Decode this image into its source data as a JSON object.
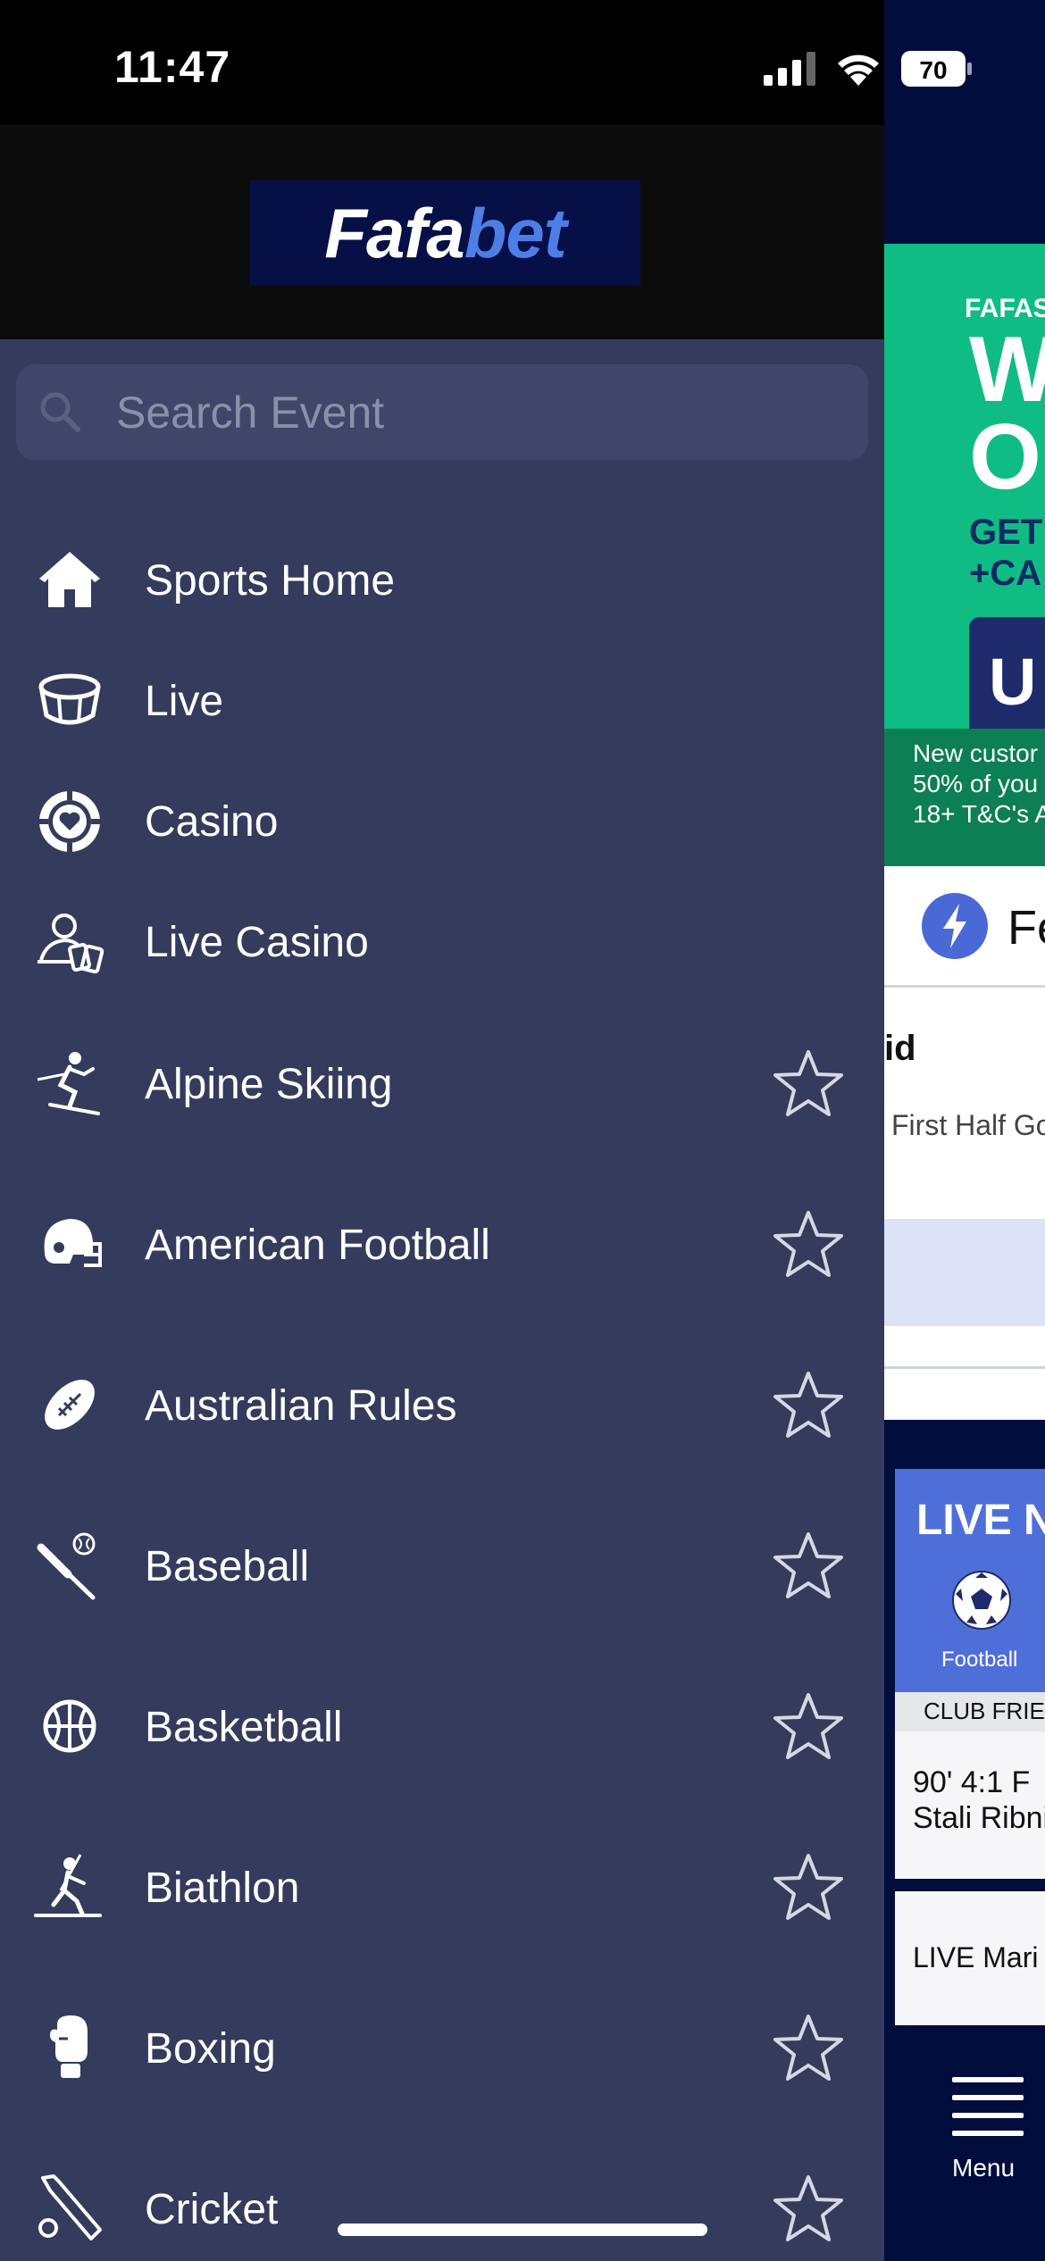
{
  "status_bar": {
    "time": "11:47",
    "battery": "70"
  },
  "brand": {
    "logo_part1": "Fafa",
    "logo_part2": "bet"
  },
  "search": {
    "placeholder": "Search Event"
  },
  "menu": {
    "items": [
      {
        "label": "Sports Home",
        "icon": "home-icon",
        "favorite": false
      },
      {
        "label": "Live",
        "icon": "stadium-icon",
        "favorite": false
      },
      {
        "label": "Casino",
        "icon": "casino-chip-icon",
        "favorite": false
      },
      {
        "label": "Live Casino",
        "icon": "live-casino-icon",
        "favorite": false
      },
      {
        "label": "Alpine Skiing",
        "icon": "alpine-skiing-icon",
        "favorite": true
      },
      {
        "label": "American Football",
        "icon": "football-helmet-icon",
        "favorite": true
      },
      {
        "label": "Australian Rules",
        "icon": "australian-rules-ball-icon",
        "favorite": true
      },
      {
        "label": "Baseball",
        "icon": "baseball-icon",
        "favorite": true
      },
      {
        "label": "Basketball",
        "icon": "basketball-icon",
        "favorite": true
      },
      {
        "label": "Biathlon",
        "icon": "biathlon-icon",
        "favorite": true
      },
      {
        "label": "Boxing",
        "icon": "boxing-glove-icon",
        "favorite": true
      },
      {
        "label": "Cricket",
        "icon": "cricket-icon",
        "favorite": true
      }
    ]
  },
  "background_page": {
    "promo": {
      "small": "FAFAS",
      "big_line1": "W",
      "big_line2": "O",
      "get_line1": "GET",
      "get_line2": "+CA",
      "button": "U",
      "footer_line1": "New custor",
      "footer_line2": "50% of you",
      "footer_line3": "18+ T&C's A"
    },
    "featured": {
      "title": "Fe",
      "id_text": "id",
      "sub": "First Half Go"
    },
    "live_now": {
      "title": "LIVE N",
      "sport": "Football",
      "league": "CLUB FRIE",
      "match1_line1": "90' 4:1   F",
      "match1_line2": "Stali Ribnit",
      "match2": "LIVE  Mari"
    },
    "bottom_menu": {
      "label": "Menu"
    }
  },
  "colors": {
    "drawer_bg": "#343b5c",
    "header_bg": "#0c0c0c",
    "brand_navy": "#061046",
    "brand_blue": "#4d7ee8",
    "promo_green": "#0fbd84"
  }
}
